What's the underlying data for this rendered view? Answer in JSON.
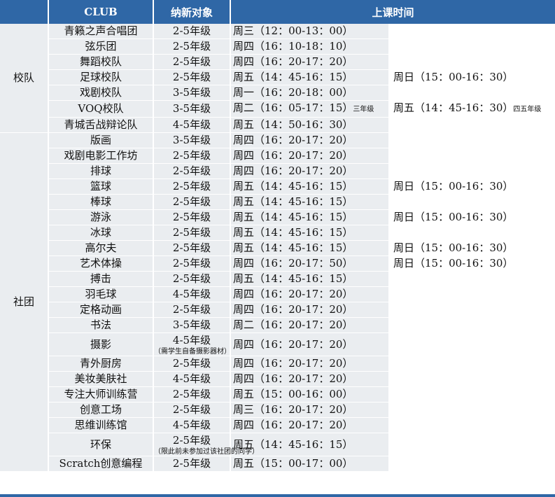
{
  "headers": {
    "club": "CLUB",
    "grade": "纳新对象",
    "time": "上课时间"
  },
  "groups": {
    "team": "校队",
    "society": "社团"
  },
  "rows": [
    {
      "club": "青籁之声合唱团",
      "grade": "2-5年级",
      "time": "周三（12：00-13：00）",
      "time2": ""
    },
    {
      "club": "弦乐团",
      "grade": "2-5年级",
      "time": "周四（16：10-18：10）",
      "time2": ""
    },
    {
      "club": "舞蹈校队",
      "grade": "2-5年级",
      "time": "周四（16：20-17：20）",
      "time2": ""
    },
    {
      "club": "足球校队",
      "grade": "2-5年级",
      "time": "周五（14：45-16：15）",
      "time2": "周日（15：00-16：30）"
    },
    {
      "club": "戏剧校队",
      "grade": "3-5年级",
      "time": "周一（16：20-18：00）",
      "time2": ""
    },
    {
      "club": "VOQ校队",
      "grade": "3-5年级",
      "time": "周二（16：05-17：15）",
      "note1": "三年级",
      "time2": "周五（14：45-16：30）",
      "note2": "四五年级"
    },
    {
      "club": "青城舌战辩论队",
      "grade": "4-5年级",
      "time": "周五（14：50-16：30）",
      "time2": ""
    },
    {
      "club": "版画",
      "grade": "3-5年级",
      "time": "周四（16：20-17：20）",
      "time2": ""
    },
    {
      "club": "戏剧电影工作坊",
      "grade": "2-5年级",
      "time": "周四（16：20-17：20）",
      "time2": ""
    },
    {
      "club": "排球",
      "grade": "2-5年级",
      "time": "周四（16：20-17：20）",
      "time2": ""
    },
    {
      "club": "篮球",
      "grade": "2-5年级",
      "time": "周五（14：45-16：15）",
      "time2": "周日（15：00-16：30）"
    },
    {
      "club": "棒球",
      "grade": "2-5年级",
      "time": "周五（14：45-16：15）",
      "time2": ""
    },
    {
      "club": "游泳",
      "grade": "2-5年级",
      "time": "周五（14：45-16：15）",
      "time2": "周日（15：00-16：30）"
    },
    {
      "club": "冰球",
      "grade": "2-5年级",
      "time": "周五（14：45-16：15）",
      "time2": ""
    },
    {
      "club": "高尔夫",
      "grade": "2-5年级",
      "time": "周五（14：45-16：15）",
      "time2": "周日（15：00-16：30）"
    },
    {
      "club": "艺术体操",
      "grade": "2-5年级",
      "time": "周四（16：20-17：50）",
      "time2": "周日（15：00-16：30）"
    },
    {
      "club": "搏击",
      "grade": "2-5年级",
      "time": "周五（14：45-16：15）",
      "time2": ""
    },
    {
      "club": "羽毛球",
      "grade": "4-5年级",
      "time": "周四（16：20-17：20）",
      "time2": ""
    },
    {
      "club": "定格动画",
      "grade": "2-5年级",
      "time": "周四（16：20-17：20）",
      "time2": ""
    },
    {
      "club": "书法",
      "grade": "3-5年级",
      "time": "周二（16：20-17：20）",
      "time2": ""
    },
    {
      "club": "摄影",
      "grade": "4-5年级",
      "grade_note": "（需学生自备摄影器材）",
      "time": "周四（16：20-17：20）",
      "time2": ""
    },
    {
      "club": "青外厨房",
      "grade": "2-5年级",
      "time": "周四（16：20-17：20）",
      "time2": ""
    },
    {
      "club": "美妆美肤社",
      "grade": "4-5年级",
      "time": "周四（16：20-17：20）",
      "time2": ""
    },
    {
      "club": "专注大师训练营",
      "grade": "2-5年级",
      "time": "周五（15：00-16：00）",
      "time2": ""
    },
    {
      "club": "创意工场",
      "grade": "2-5年级",
      "time": "周三（16：20-17：20）",
      "time2": ""
    },
    {
      "club": "思维训练馆",
      "grade": "4-5年级",
      "time": "周四（16：20-17：20）",
      "time2": ""
    },
    {
      "club": "环保",
      "grade": "2-5年级",
      "grade_note": "（限此前未参加过该社团的同学）",
      "time": "周五（14：45-16：15）",
      "time2": ""
    },
    {
      "club": "Scratch创意编程",
      "grade": "2-5年级",
      "time": "周五（15：00-17：00）",
      "time2": ""
    }
  ]
}
